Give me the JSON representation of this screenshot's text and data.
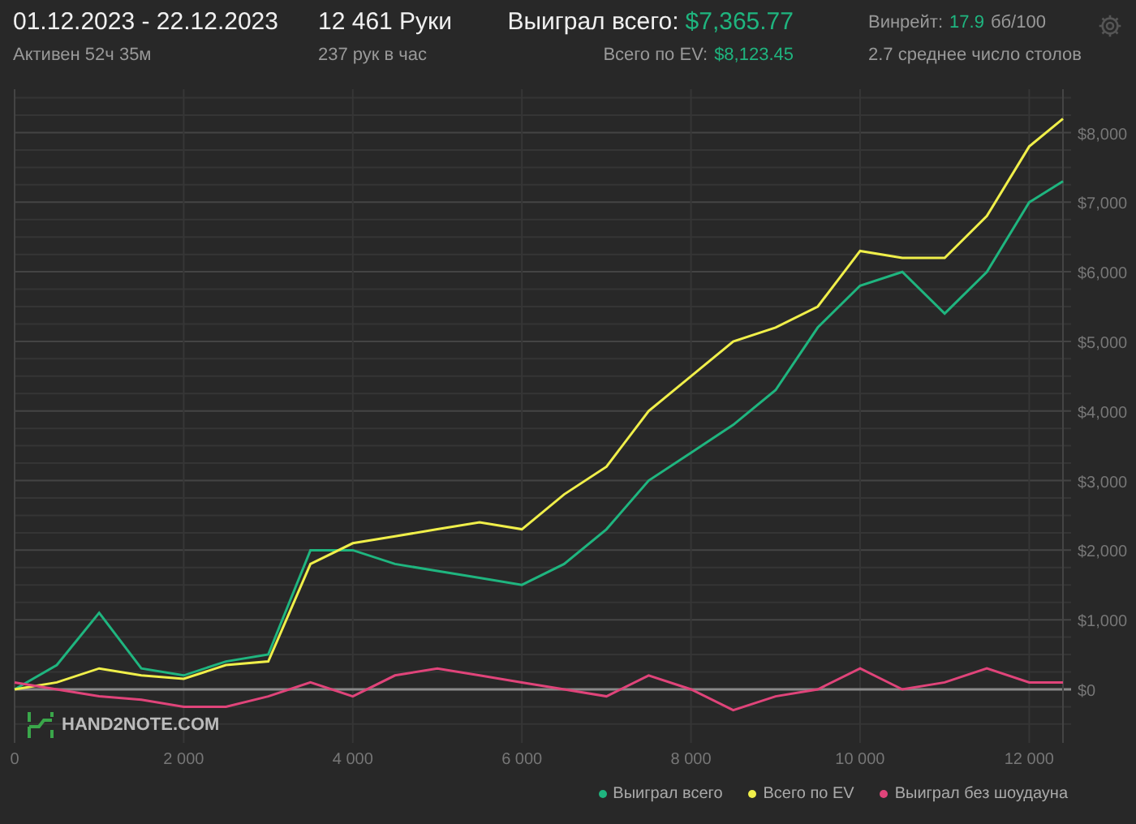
{
  "header": {
    "period": "01.12.2023 - 22.12.2023",
    "active": "Активен 52ч 35м",
    "hands": "12 461 Руки",
    "hands_per_hour": "237 рук в час",
    "won_total": {
      "label": "Выиграл всего:",
      "value": "$7,365.77"
    },
    "ev_total": {
      "label": "Всего по EV:",
      "value": "$8,123.45"
    },
    "winrate": {
      "label": "Винрейт:",
      "value": "17.9",
      "unit": "бб/100"
    },
    "tables": "2.7 среднее число столов"
  },
  "chart": {
    "logo": "HAND2NOTE.COM",
    "chart_data": {
      "type": "line",
      "x": [
        0,
        500,
        1000,
        1500,
        2000,
        2500,
        3000,
        3500,
        4000,
        4500,
        5000,
        5500,
        6000,
        6500,
        7000,
        7500,
        8000,
        8500,
        9000,
        9500,
        10000,
        10500,
        11000,
        11500,
        12000,
        12400
      ],
      "series": [
        {
          "name": "Выиграл всего",
          "color": "#1fb57f",
          "values": [
            0,
            350,
            1100,
            300,
            200,
            400,
            500,
            2000,
            2000,
            1800,
            1700,
            1600,
            1500,
            1800,
            2300,
            3000,
            3400,
            3800,
            4300,
            5200,
            5800,
            6000,
            5400,
            6000,
            7000,
            7300
          ]
        },
        {
          "name": "Всего по EV",
          "color": "#f0ef4a",
          "values": [
            0,
            100,
            300,
            200,
            150,
            350,
            400,
            1800,
            2100,
            2200,
            2300,
            2400,
            2300,
            2800,
            3200,
            4000,
            4500,
            5000,
            5200,
            5500,
            6300,
            6200,
            6200,
            6800,
            7800,
            8200
          ]
        },
        {
          "name": "Выиграл без шоудауна",
          "color": "#e0447a",
          "values": [
            100,
            0,
            -100,
            -150,
            -250,
            -250,
            -100,
            100,
            -100,
            200,
            300,
            200,
            100,
            0,
            -100,
            200,
            0,
            -300,
            -100,
            0,
            300,
            0,
            100,
            300,
            100,
            100
          ]
        }
      ],
      "xlim": [
        0,
        12400
      ],
      "ylim": [
        -770,
        8640
      ],
      "grid": true,
      "xticks": [
        0,
        {
          "value": 2000,
          "label": "2 000"
        },
        {
          "value": 4000,
          "label": "4 000"
        },
        {
          "value": 6000,
          "label": "6 000"
        },
        {
          "value": 8000,
          "label": "8 000"
        },
        {
          "value": 10000,
          "label": "10 000"
        },
        {
          "value": 12000,
          "label": "12 000"
        }
      ],
      "yticks": [
        {
          "value": 0,
          "label": "$0"
        },
        {
          "value": 1000,
          "label": "$1,000"
        },
        {
          "value": 2000,
          "label": "$2,000"
        },
        {
          "value": 3000,
          "label": "$3,000"
        },
        {
          "value": 4000,
          "label": "$4,000"
        },
        {
          "value": 5000,
          "label": "$5,000"
        },
        {
          "value": 6000,
          "label": "$6,000"
        },
        {
          "value": 7000,
          "label": "$7,000"
        },
        {
          "value": 8000,
          "label": "$8,000"
        }
      ]
    }
  }
}
